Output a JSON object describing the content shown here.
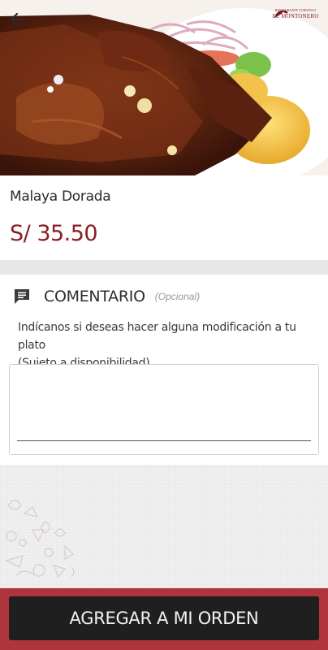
{
  "header": {
    "back_icon": "arrow-left-icon",
    "logo": {
      "text": "EL MONTONERO",
      "subtext": "RESTAURANTE TURISTICO"
    }
  },
  "product": {
    "name": "Malaya Dorada",
    "price": "S/  35.50"
  },
  "comment": {
    "icon": "comment-icon",
    "title": "COMENTARIO",
    "optional_label": "(Opcional)",
    "help_line1": "Indícanos si deseas hacer alguna modificación a tu plato",
    "help_line2": "(Sujeto a disponibilidad)",
    "value": ""
  },
  "footer": {
    "order_button_label": "AGREGAR A MI ORDEN"
  },
  "colors": {
    "brand": "#8b1e27",
    "bottom_bar": "#b0343c",
    "button": "#1f1f1f"
  }
}
